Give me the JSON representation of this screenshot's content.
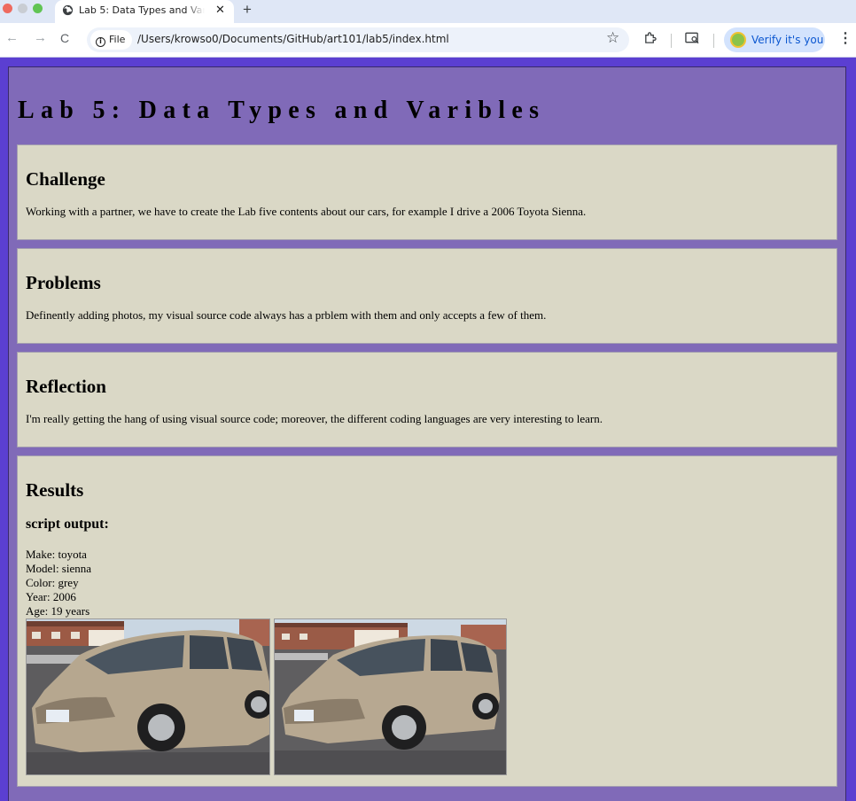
{
  "browser": {
    "tab_title": "Lab 5: Data Types and Varibles",
    "tab_close": "✕",
    "new_tab": "+",
    "back": "←",
    "forward": "→",
    "reload": "C",
    "file_chip": "File",
    "file_chip_icon": "i",
    "url": "/Users/krowso0/Documents/GitHub/art101/lab5/index.html",
    "star": "☆",
    "verify_label": "Verify it's you",
    "menu": "⋮"
  },
  "page": {
    "title": "Lab 5: Data Types and Varibles",
    "sections": [
      {
        "heading": "Challenge",
        "text": "Working with a partner, we have to create the Lab five contents about our cars, for example I drive a 2006 Toyota Sienna."
      },
      {
        "heading": "Problems",
        "text": "Definently adding photos, my visual source code always has a prblem with them and only accepts a few of them."
      },
      {
        "heading": "Reflection",
        "text": "I'm really getting the hang of using visual source code; moreover, the different coding languages are very interesting to learn."
      }
    ],
    "results": {
      "heading": "Results",
      "subheading": "script output:",
      "lines": [
        "Make: toyota",
        "Model: sienna",
        "Color: grey",
        "Year: 2006",
        "Age: 19 years"
      ]
    }
  },
  "colors": {
    "viewport_bg": "#5b3fd1",
    "container_bg": "#806ab8",
    "card_bg": "#dad8c6"
  },
  "icons": [
    "globe-icon",
    "close-icon",
    "plus-icon",
    "back-arrow-icon",
    "forward-arrow-icon",
    "reload-icon",
    "info-icon",
    "star-icon",
    "extension-icon",
    "media-icon",
    "avatar-icon",
    "menu-icon"
  ]
}
